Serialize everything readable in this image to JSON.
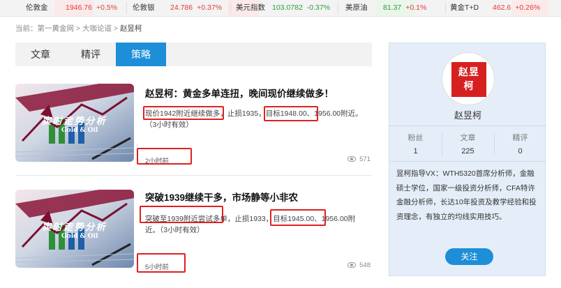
{
  "ticker": [
    {
      "name": "伦敦金",
      "price": "1946.76",
      "change": "+0.5%",
      "dir": "up"
    },
    {
      "name": "伦敦银",
      "price": "24.786",
      "change": "+0.37%",
      "dir": "up"
    },
    {
      "name": "美元指数",
      "price": "103.0782",
      "change": "-0.37%",
      "dir": "down"
    },
    {
      "name": "美原油",
      "price": "81.37",
      "change": "+0.1%",
      "dir": "up"
    },
    {
      "name": "黄金T+D",
      "price": "462.6",
      "change": "+0.26%",
      "dir": "up"
    }
  ],
  "breadcrumb": {
    "prefix": "当前：",
    "items": [
      "第一黄金网",
      "大咖论道"
    ],
    "separator": " > ",
    "current": "赵昱柯"
  },
  "tabs": [
    {
      "label": "文章",
      "active": false
    },
    {
      "label": "精评",
      "active": false
    },
    {
      "label": "策略",
      "active": true
    }
  ],
  "thumb": {
    "text": "实时走势分析",
    "sub": "Gold & Oil"
  },
  "articles": [
    {
      "title": "赵昱柯：黄金多单连扭，晚间现价继续做多！",
      "body": "现价1942附近继续做多，止损1935，目标1948.00、1956.00附近。（3小时有效）",
      "time": "2小时前",
      "views": "571"
    },
    {
      "title": "突破1939继续干多，市场静等小非农",
      "body": "突破至1939附近尝试多单，止损1933，目标1945.00、1956.00附近。（3小时有效）",
      "time": "5小时前",
      "views": "548"
    }
  ],
  "profile": {
    "avatar_text": "赵昱柯",
    "name": "赵昱柯",
    "stats": [
      {
        "label": "粉丝",
        "value": "1"
      },
      {
        "label": "文章",
        "value": "225"
      },
      {
        "label": "精评",
        "value": "0"
      }
    ],
    "bio": "昱柯指导VX：WTH5320首席分析师，金融硕士学位，国家一级投资分析师，CFA特许金融分析师，长达10年投资及教学经验和投资理念，有独立的均线实用技巧。",
    "follow_label": "关注"
  },
  "colors": {
    "accent": "#1e8ed8",
    "up": "#e53935",
    "down": "#2a9d3a",
    "highlight": "#e02020"
  }
}
